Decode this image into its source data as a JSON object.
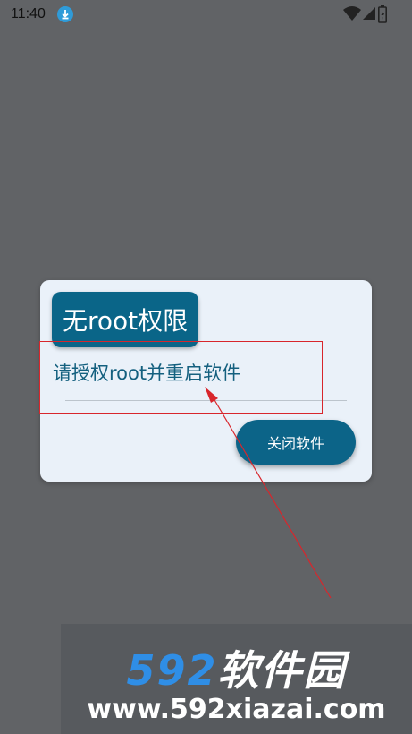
{
  "status_bar": {
    "time": "11:40",
    "icons": [
      "download-icon",
      "wifi-icon",
      "signal-icon",
      "battery-icon"
    ]
  },
  "dialog": {
    "title": "无root权限",
    "message": "请授权root并重启软件",
    "close_button_label": "关闭软件"
  },
  "watermark": {
    "brand_number": "592",
    "brand_text": "软件园",
    "url": "www.592xiazai.com"
  },
  "colors": {
    "accent": "#0a6588",
    "dialog_bg": "#eaf1f9",
    "backdrop": "#616366",
    "annotation": "#d8262c"
  }
}
